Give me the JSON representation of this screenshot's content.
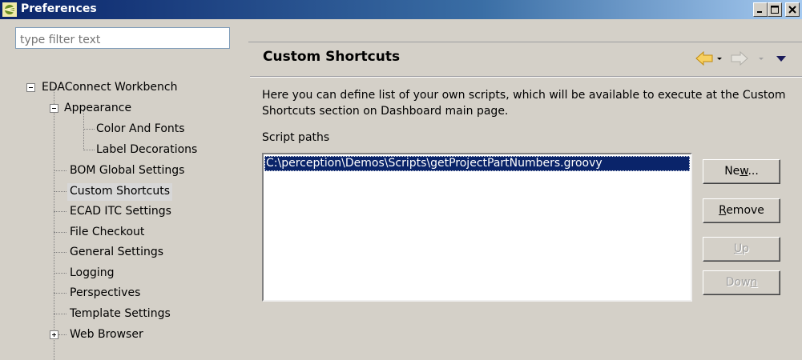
{
  "window": {
    "title": "Preferences",
    "accent_color": "#0a246a",
    "controls": [
      "minimize-icon",
      "maximize-icon",
      "close-icon"
    ]
  },
  "sidebar": {
    "filter_placeholder": "type filter text",
    "items": [
      {
        "label": "EDAConnect Workbench",
        "expander": "minus"
      },
      {
        "label": "Appearance",
        "expander": "minus"
      },
      {
        "label": "Color And Fonts"
      },
      {
        "label": "Label Decorations"
      },
      {
        "label": "BOM Global Settings"
      },
      {
        "label": "Custom Shortcuts",
        "selected": true
      },
      {
        "label": "ECAD ITC Settings"
      },
      {
        "label": "File Checkout"
      },
      {
        "label": "General Settings"
      },
      {
        "label": "Logging"
      },
      {
        "label": "Perspectives"
      },
      {
        "label": "Template Settings"
      },
      {
        "label": "Web Browser",
        "expander": "plus"
      }
    ]
  },
  "page": {
    "title": "Custom Shortcuts",
    "nav_icons": [
      "back-arrow-icon",
      "back-dropdown-icon",
      "forward-arrow-icon",
      "forward-dropdown-icon",
      "view-menu-icon"
    ],
    "description": "Here you can define list of your own scripts, which will be available to execute at the Custom Shortcuts section on Dashboard main page.",
    "script_paths_label": "Script paths",
    "script_paths": [
      "C:\\perception\\Demos\\Scripts\\getProjectPartNumbers.groovy"
    ]
  },
  "buttons": {
    "new_pre": "Ne",
    "new_key": "w",
    "new_post": "...",
    "remove_key": "R",
    "remove_post": "emove",
    "up_key": "U",
    "up_post": "p",
    "down_pre": "Dow",
    "down_key": "n"
  }
}
